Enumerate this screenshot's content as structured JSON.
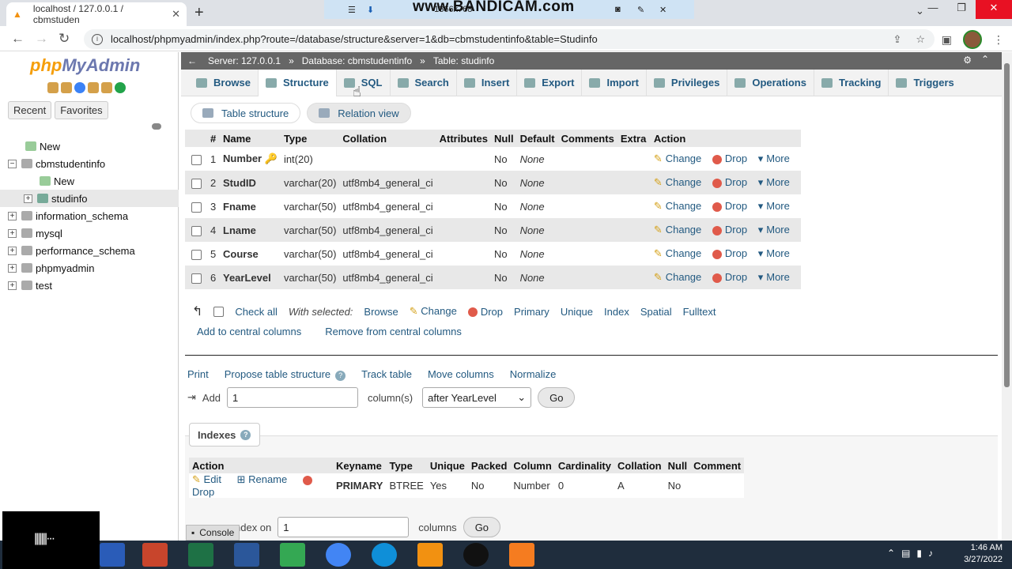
{
  "browser": {
    "tab_title": "localhost / 127.0.0.1 / cbmstuden",
    "url": "localhost/phpmyadmin/index.php?route=/database/structure&server=1&db=cbmstudentinfo&table=Studinfo",
    "recorder_watermark": "www.BANDICAM.com",
    "recorder_resolution": "1366x768"
  },
  "sidebar": {
    "logo_php": "php",
    "logo_myadmin": "MyAdmin",
    "recent": "Recent",
    "favorites": "Favorites",
    "tree": [
      {
        "label": "New",
        "level": 1
      },
      {
        "label": "cbmstudentinfo",
        "level": 0
      },
      {
        "label": "New",
        "level": 2
      },
      {
        "label": "studinfo",
        "level": 2
      },
      {
        "label": "information_schema",
        "level": 0
      },
      {
        "label": "mysql",
        "level": 0
      },
      {
        "label": "performance_schema",
        "level": 0
      },
      {
        "label": "phpmyadmin",
        "level": 0
      },
      {
        "label": "test",
        "level": 0
      }
    ]
  },
  "breadcrumb": {
    "server": "Server: 127.0.0.1",
    "database": "Database: cbmstudentinfo",
    "table": "Table: studinfo"
  },
  "tabs": [
    "Browse",
    "Structure",
    "SQL",
    "Search",
    "Insert",
    "Export",
    "Import",
    "Privileges",
    "Operations",
    "Tracking",
    "Triggers"
  ],
  "subtabs": [
    "Table structure",
    "Relation view"
  ],
  "columns_table": {
    "headers": [
      "#",
      "Name",
      "Type",
      "Collation",
      "Attributes",
      "Null",
      "Default",
      "Comments",
      "Extra",
      "Action"
    ],
    "rows": [
      {
        "num": "1",
        "name": "Number",
        "type": "int(20)",
        "collation": "",
        "null": "No",
        "default": "None"
      },
      {
        "num": "2",
        "name": "StudID",
        "type": "varchar(20)",
        "collation": "utf8mb4_general_ci",
        "null": "No",
        "default": "None"
      },
      {
        "num": "3",
        "name": "Fname",
        "type": "varchar(50)",
        "collation": "utf8mb4_general_ci",
        "null": "No",
        "default": "None"
      },
      {
        "num": "4",
        "name": "Lname",
        "type": "varchar(50)",
        "collation": "utf8mb4_general_ci",
        "null": "No",
        "default": "None"
      },
      {
        "num": "5",
        "name": "Course",
        "type": "varchar(50)",
        "collation": "utf8mb4_general_ci",
        "null": "No",
        "default": "None"
      },
      {
        "num": "6",
        "name": "YearLevel",
        "type": "varchar(50)",
        "collation": "utf8mb4_general_ci",
        "null": "No",
        "default": "None"
      }
    ],
    "actions": {
      "change": "Change",
      "drop": "Drop",
      "more": "More"
    }
  },
  "with_selected": {
    "check_all": "Check all",
    "label": "With selected:",
    "items": [
      "Browse",
      "Change",
      "Drop",
      "Primary",
      "Unique",
      "Index",
      "Spatial",
      "Fulltext"
    ],
    "add_central": "Add to central columns",
    "remove_central": "Remove from central columns"
  },
  "tools": [
    "Print",
    "Propose table structure",
    "Track table",
    "Move columns",
    "Normalize"
  ],
  "add_columns": {
    "label": "Add",
    "count": "1",
    "suffix": "column(s)",
    "position": "after YearLevel",
    "go": "Go"
  },
  "indexes": {
    "legend": "Indexes",
    "headers": [
      "Action",
      "Keyname",
      "Type",
      "Unique",
      "Packed",
      "Column",
      "Cardinality",
      "Collation",
      "Null",
      "Comment"
    ],
    "row": {
      "edit": "Edit",
      "rename": "Rename",
      "drop": "Drop",
      "keyname": "PRIMARY",
      "type": "BTREE",
      "unique": "Yes",
      "packed": "No",
      "column": "Number",
      "cardinality": "0",
      "collation": "A",
      "null": "No",
      "comment": ""
    },
    "create_label": "ndex on",
    "create_value": "1",
    "create_suffix": "columns",
    "go": "Go"
  },
  "console": "Console",
  "clock": {
    "time": "1:46 AM",
    "date": "3/27/2022"
  }
}
